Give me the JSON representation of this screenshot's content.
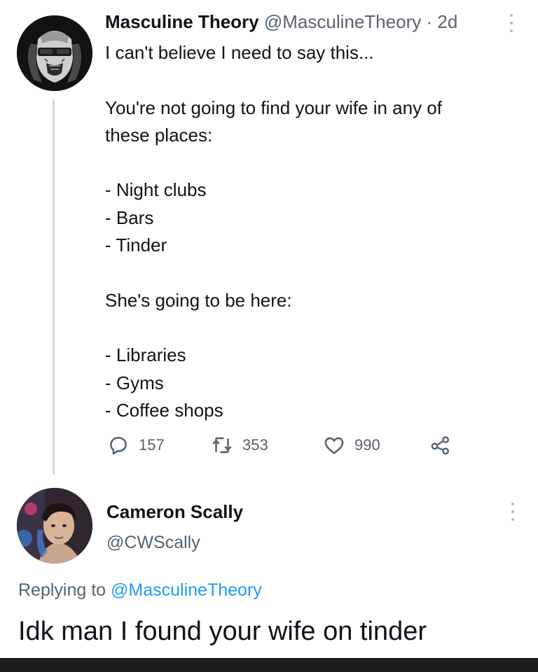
{
  "tweet": {
    "author_name": "Masculine Theory",
    "author_handle": "@MasculineTheory",
    "separator": "·",
    "time": "2d",
    "avatar_icon": "skull-mask-avatar",
    "text_lines": [
      "I can't believe I need to say this...",
      "",
      "You're not going to find your wife in any of",
      "these places:",
      "",
      "- Night clubs",
      "- Bars",
      "- Tinder",
      "",
      "She's going to be here:",
      "",
      "- Libraries",
      "- Gyms",
      "- Coffee shops"
    ],
    "reply_count": "157",
    "retweet_count": "353",
    "like_count": "990",
    "icons": [
      "reply-icon",
      "retweet-icon",
      "like-icon",
      "share-icon",
      "more-icon"
    ]
  },
  "reply": {
    "author_name": "Cameron Scally",
    "author_handle": "@CWScally",
    "avatar_icon": "user-photo-avatar",
    "replying_prefix": "Replying to",
    "replying_mention": "@MasculineTheory",
    "text": "Idk man I found your wife on tinder"
  },
  "colors": {
    "text": "#0f1419",
    "secondary": "#536471",
    "link": "#1d9bf0",
    "thread_line": "#cfd9de"
  }
}
